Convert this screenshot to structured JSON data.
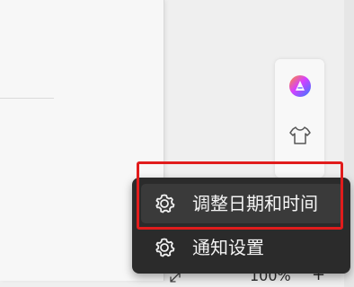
{
  "colors": {
    "accent": "#e11c1c",
    "menu_background": "#2b2b2b",
    "menu_hover": "#3a3a3a",
    "menu_text": "#f4f4f4"
  },
  "side_dock": {
    "items": [
      {
        "icon": "copilot-icon"
      },
      {
        "icon": "shirt-icon"
      }
    ]
  },
  "context_menu": {
    "items": [
      {
        "icon": "gear-icon",
        "label": "调整日期和时间"
      },
      {
        "icon": "gear-icon",
        "label": "通知设置"
      }
    ]
  },
  "bottom_bar": {
    "zoom_level": "100%",
    "zoom_in": "+"
  }
}
